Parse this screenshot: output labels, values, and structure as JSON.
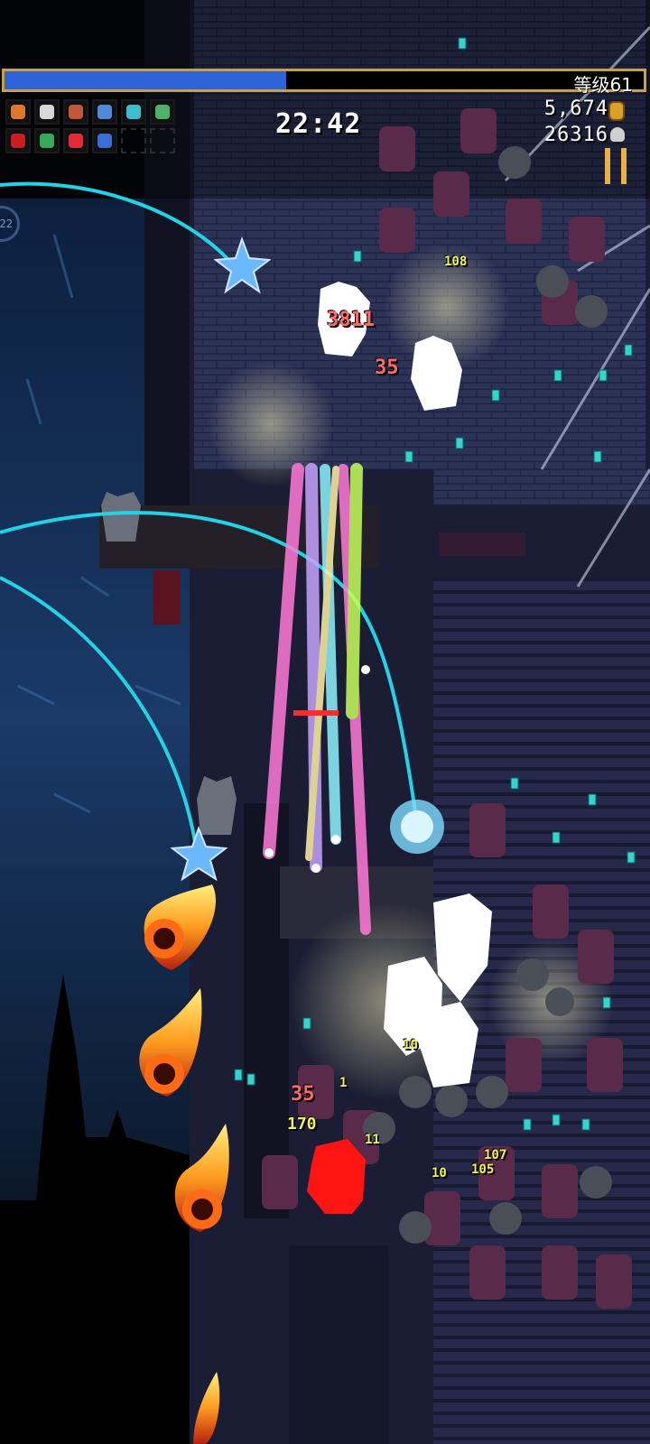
{
  "hud": {
    "level_label": "等级61",
    "xp_progress": 0.44,
    "timer": "22:42",
    "gold": "5,674",
    "kills": "26316",
    "level_indicator": "22"
  },
  "weapons": [
    "fire-orb-icon",
    "skull-icon",
    "clock-icon",
    "wand-icon",
    "bird-icon",
    "vine-icon"
  ],
  "passives": [
    "red-tome-icon",
    "feather-icon",
    "heart-icon",
    "ring-icon",
    "empty-slot",
    "empty-slot"
  ],
  "damage_numbers": [
    "3811",
    "35",
    "35",
    "170"
  ],
  "small_numbers": [
    "108",
    "10",
    "107",
    "105",
    "11",
    "10",
    "1"
  ],
  "colors": {
    "xp_fill": "#2f63d8",
    "xp_border": "#c9a04a",
    "pause": "#e7b048",
    "laser_pink": "#ff7ad9",
    "laser_cyan": "#8ef3ff",
    "laser_green": "#c7ff5a",
    "orbit_arc": "#22d3e6"
  }
}
